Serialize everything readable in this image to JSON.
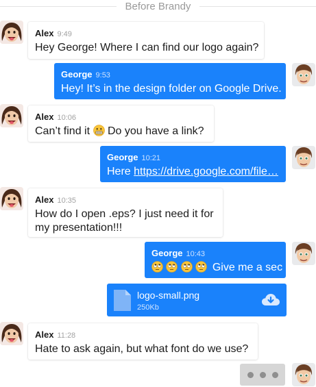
{
  "divider": {
    "label": "Before Brandy"
  },
  "messages": [
    {
      "author": "Alex",
      "time": "9:49",
      "text": "Hey George! Where I can find our logo again?"
    },
    {
      "author": "George",
      "time": "9:53",
      "text": "Hey! It’s in the design folder on Google Drive."
    },
    {
      "author": "Alex",
      "time": "10:06",
      "text_before": "Can’t find it",
      "emoji": "grimacing-emoji",
      "text_after": "Do you have a link?"
    },
    {
      "author": "George",
      "time": "10:21",
      "text_prefix": "Here ",
      "link": "https://drive.google.com/file…"
    },
    {
      "author": "Alex",
      "time": "10:35",
      "lines": [
        "How do I open .eps? I just need it for",
        "my presentation!!!"
      ]
    },
    {
      "author": "George",
      "time": "10:43",
      "emoji": "eye-roll-emoji",
      "emoji_count": 4,
      "text": "Give me a sec"
    },
    {
      "author": "Alex",
      "time": "11:28",
      "text": "Hate to ask again, but what font do we use?"
    }
  ],
  "attachment": {
    "file_name": "logo-small.png",
    "file_size": "250Kb",
    "icon": "file-icon",
    "action_icon": "cloud-download-icon"
  },
  "typing_indicator": {
    "icon": "typing-dots-icon"
  },
  "colors": {
    "outgoing_bubble": "#1a82fb",
    "incoming_bubble": "#ffffff",
    "typing_bubble": "#d6d6d6"
  }
}
